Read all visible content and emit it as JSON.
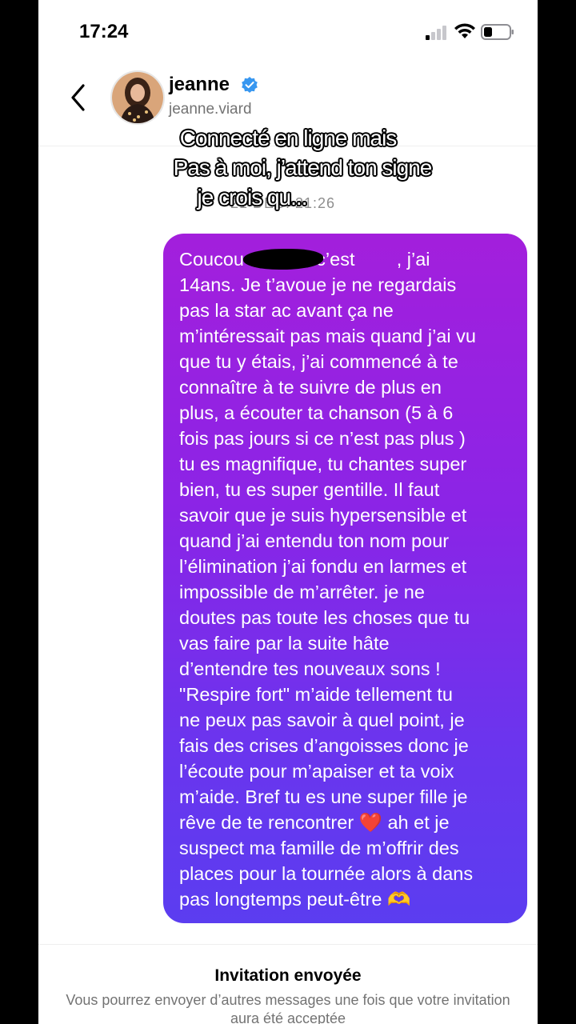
{
  "status_bar": {
    "time": "17:24",
    "signal_icon": "signal-icon",
    "wifi_icon": "wifi-icon",
    "battery_icon": "battery-icon"
  },
  "header": {
    "back_icon": "chevron-left-icon",
    "name": "jeanne",
    "verified_icon": "verified-badge-icon",
    "handle": "jeanne.viard",
    "verified_color": "#3897f0"
  },
  "overlay_caption": {
    "line1": "Connecté en ligne mais",
    "line2": "Pas à moi, j’attend ton signe",
    "line3": "je crois qu..."
  },
  "date_separator": "21 DÉC. 21:26",
  "message": {
    "text": "Coucou Jeanne c’est        , j’ai\n14ans. Je t’avoue je ne regardais\npas la star ac avant ça ne\nm’intéressait pas mais quand j’ai vu\nque tu y étais, j’ai commencé à te\nconnaître à te suivre de plus en\nplus, a écouter ta chanson (5 à 6\nfois pas jours si ce n’est pas plus )\ntu es magnifique, tu chantes super\nbien, tu es super gentille. Il faut\nsavoir que je suis hypersensible et\nquand j’ai entendu ton nom pour\nl’élimination j’ai fondu en larmes et\nimpossible de m’arrêter. je ne\ndoutes pas toute les choses que tu\nvas faire par la suite hâte\nd’entendre tes nouveaux sons !\n\"Respire fort\" m’aide tellement tu\nne peux pas savoir à quel point, je\nfais des crises d’angoisses donc je\nl’écoute pour m’apaiser et ta voix\nm’aide. Bref tu es une super fille je\nrêve de te rencontrer ❤️ ah et je\nsuspect ma famille de m’offrir des\nplaces pour la tournée alors à dans\npas longtemps peut-être 🫶",
    "gradient_top": "#a31fdc",
    "gradient_bottom": "#5b3df0"
  },
  "footer": {
    "title": "Invitation envoyée",
    "subtitle": "Vous pourrez envoyer d’autres messages une fois que votre invitation aura été acceptée"
  }
}
